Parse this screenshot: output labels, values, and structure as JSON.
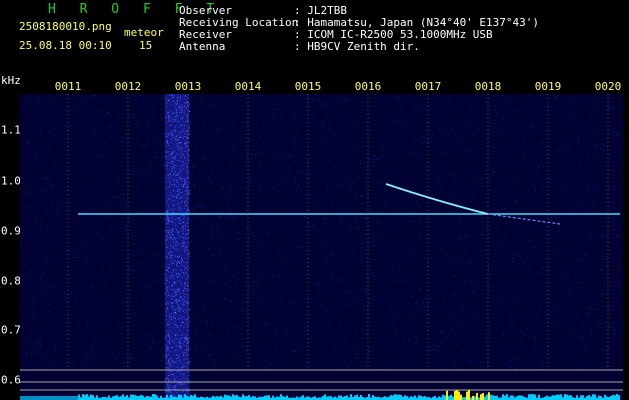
{
  "app": {
    "title": "H R O F F T",
    "filename": "2508180010.png",
    "datetime": "25.08.18 00:10",
    "meteor_label": "meteor",
    "meteor_count": "15"
  },
  "station": [
    {
      "label": "Observer",
      "value": ": JL2TBB"
    },
    {
      "label": "Receiving Location",
      "value": ": Hamamatsu, Japan (N34°40' E137°43')"
    },
    {
      "label": "Receiver",
      "value": ": ICOM IC-R2500 53.1000MHz USB"
    },
    {
      "label": "Antenna",
      "value": ": HB9CV Zenith dir."
    }
  ],
  "plot": {
    "y_unit": "kHz",
    "x_ticks": [
      "0011",
      "0012",
      "0013",
      "0014",
      "0015",
      "0016",
      "0017",
      "0018",
      "0019",
      "0020"
    ],
    "y_ticks": [
      "1.1",
      "1.0",
      "0.9",
      "0.8",
      "0.7",
      "0.6"
    ],
    "carrier_khz": 0.93,
    "colors": {
      "background": "#000033",
      "noise": "#1a1acc",
      "carrier": "#44ddff",
      "streak": "#6688ff",
      "trail": "#88eeff",
      "level": "#00ccff",
      "level_peak": "#ffee00",
      "grid": "#777777",
      "frame": "#aaaaaa"
    }
  }
}
